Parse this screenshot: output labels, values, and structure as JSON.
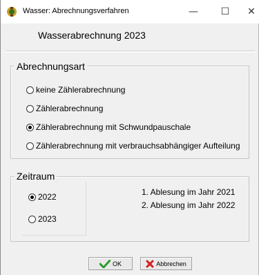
{
  "window": {
    "title": "Wasser: Abrechnungsverfahren",
    "minimize_glyph": "—",
    "maximize_glyph": "☐",
    "close_glyph": "✕",
    "icon": "application-icon"
  },
  "header": {
    "text": "Wasserabrechnung  2023"
  },
  "billing_type": {
    "label": "Abrechnungsart",
    "options": [
      {
        "label": "keine Zählerabrechnung",
        "checked": false
      },
      {
        "label": "Zählerabrechnung",
        "checked": false
      },
      {
        "label": "Zählerabrechnung mit Schwundpauschale",
        "checked": true
      },
      {
        "label": "Zählerabrechnung mit verbrauchsabhängiger Aufteilung",
        "checked": false
      }
    ]
  },
  "period": {
    "label": "Zeitraum",
    "options": [
      {
        "label": "2022",
        "checked": true
      },
      {
        "label": "2023",
        "checked": false
      }
    ],
    "info": [
      "1. Ablesung im Jahr 2021",
      "2. Ablesung im Jahr 2022"
    ]
  },
  "buttons": {
    "ok_label": "OK",
    "ok_icon": "checkmark-icon",
    "cancel_label": "Abbrechen",
    "cancel_icon": "x-icon",
    "ok_icon_color": "#2e9a2e",
    "cancel_icon_color": "#d02020"
  }
}
